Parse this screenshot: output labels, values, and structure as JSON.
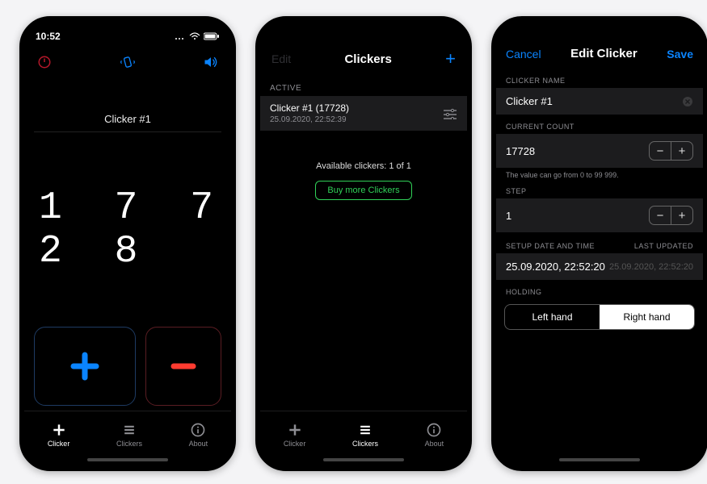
{
  "status_time": "10:52",
  "colors": {
    "accent": "#0a84ff",
    "danger": "#ff3b30",
    "success": "#30d158"
  },
  "phone1": {
    "title": "Clicker #1",
    "count": "1 7 7 2 8",
    "tabs": {
      "clicker": "Clicker",
      "clickers": "Clickers",
      "about": "About"
    }
  },
  "phone2": {
    "nav": {
      "edit": "Edit",
      "title": "Clickers",
      "add": "+"
    },
    "section_active": "ACTIVE",
    "active_item": {
      "line1": "Clicker #1 (17728)",
      "line2": "25.09.2020, 22:52:39"
    },
    "available": "Available clickers: 1 of 1",
    "buy": "Buy more Clickers",
    "tabs": {
      "clicker": "Clicker",
      "clickers": "Clickers",
      "about": "About"
    }
  },
  "phone3": {
    "nav": {
      "cancel": "Cancel",
      "title": "Edit Clicker",
      "save": "Save"
    },
    "headers": {
      "name": "CLICKER NAME",
      "count": "CURRENT COUNT",
      "step": "STEP",
      "setup": "SETUP DATE AND TIME",
      "updated": "LAST UPDATED",
      "holding": "HOLDING"
    },
    "name": "Clicker #1",
    "count": "17728",
    "count_hint": "The value can go from 0 to 99 999.",
    "step": "1",
    "setup_date": "25.09.2020, 22:52:20",
    "last_updated": "25.09.2020, 22:52:20",
    "holding": {
      "left": "Left hand",
      "right": "Right hand"
    }
  }
}
